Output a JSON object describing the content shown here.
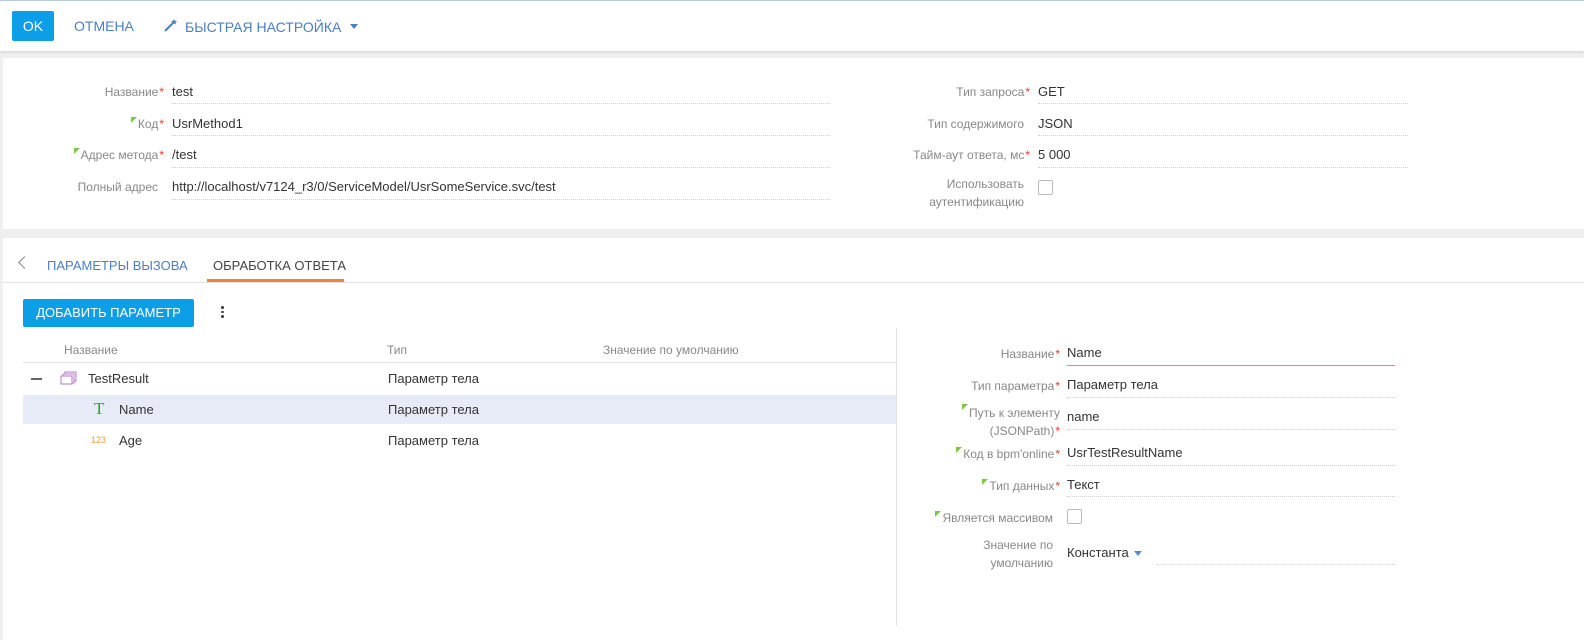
{
  "toolbar": {
    "ok_label": "OK",
    "cancel_label": "ОТМЕНА",
    "quick_setup_label": "БЫСТРАЯ НАСТРОЙКА"
  },
  "method": {
    "name_label": "Название",
    "name_value": "test",
    "code_label": "Код",
    "code_value": "UsrMethod1",
    "address_label": "Адрес метода",
    "address_value": "/test",
    "full_address_label": "Полный адрес",
    "full_address_value": "http://localhost/v7124_r3/0/ServiceModel/UsrSomeService.svc/test",
    "request_type_label": "Тип запроса",
    "request_type_value": "GET",
    "content_type_label": "Тип содержимого",
    "content_type_value": "JSON",
    "timeout_label": "Тайм-аут ответа, мс",
    "timeout_value": "5 000",
    "use_auth_label_1": "Использовать",
    "use_auth_label_2": "аутентификацию",
    "required_mark": "*"
  },
  "tabs": [
    {
      "label": "ПАРАМЕТРЫ ВЫЗОВА"
    },
    {
      "label": "ОБРАБОТКА ОТВЕТА"
    }
  ],
  "params": {
    "add_button_label": "ДОБАВИТЬ ПАРАМЕТР",
    "columns": [
      "Название",
      "Тип",
      "Значение по умолчанию"
    ],
    "rows": [
      {
        "name": "TestResult",
        "type": "Параметр тела",
        "icon": "object-icon"
      },
      {
        "name": "Name",
        "type": "Параметр тела",
        "icon": "text-type-icon",
        "icon_glyph": "T"
      },
      {
        "name": "Age",
        "type": "Параметр тела",
        "icon": "number-type-icon",
        "icon_glyph": "123"
      }
    ]
  },
  "details": {
    "name_label": "Название",
    "name_value": "Name",
    "param_type_label": "Тип параметра",
    "param_type_value": "Параметр тела",
    "path_label_1": "Путь к элементу",
    "path_label_2": "(JSONPath)",
    "path_value": "name",
    "code_label": "Код в bpm'online",
    "code_value": "UsrTestResultName",
    "data_type_label": "Тип данных",
    "data_type_value": "Текст",
    "is_array_label": "Является массивом",
    "default_label_1": "Значение по",
    "default_label_2": "умолчанию",
    "default_value": "Константа"
  },
  "colors": {
    "accent": "#0d9ee8",
    "link": "#4a7fc1",
    "required": "#e33333",
    "tab_active": "#f0803c",
    "selected_row": "#e6ebf7"
  }
}
